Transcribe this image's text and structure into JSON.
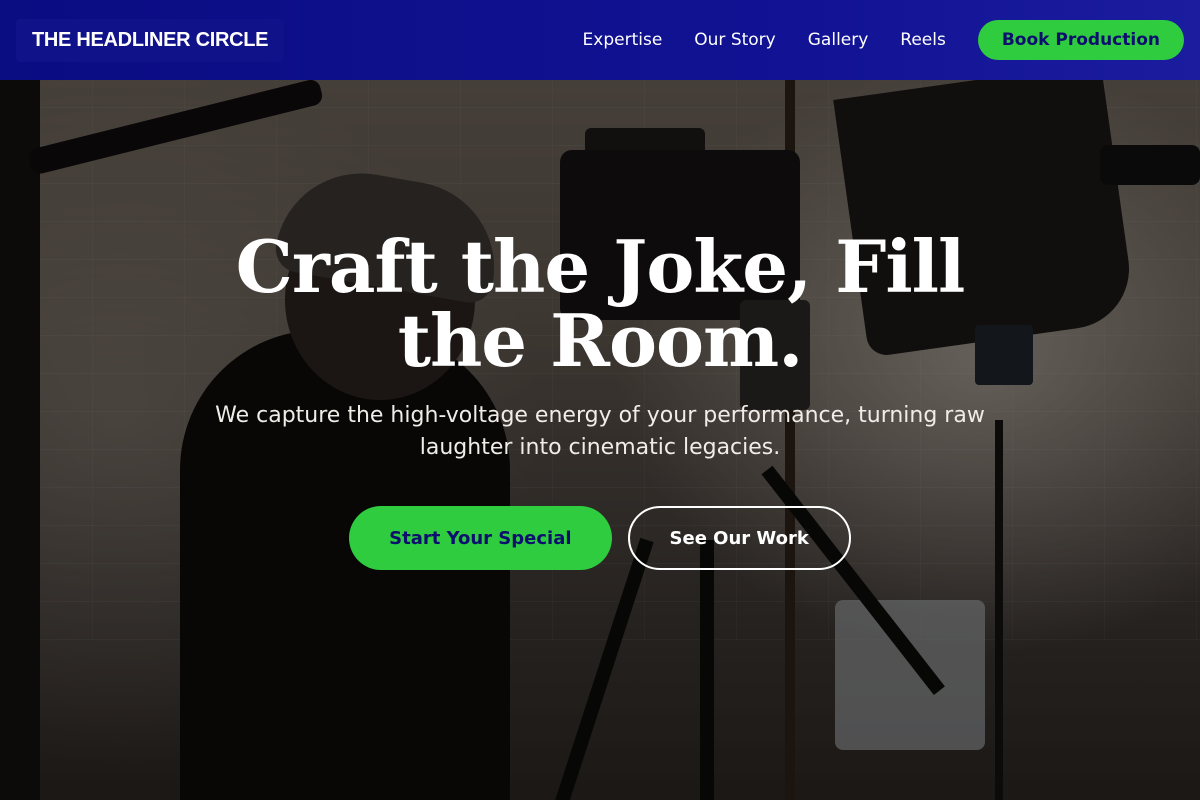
{
  "nav": {
    "brand": "THE HEADLINER CIRCLE",
    "links": [
      "Expertise",
      "Our Story",
      "Gallery",
      "Reels"
    ],
    "cta_label": "Book Production"
  },
  "hero": {
    "headline": "Craft the Joke, Fill the Room.",
    "subline": "We capture the high-voltage energy of your performance, turning raw laughter into cinematic legacies.",
    "primary_button": "Start Your Special",
    "secondary_button": "See Our Work"
  },
  "colors": {
    "nav_bg": "#0a0c82",
    "accent_green": "#2ecc3e",
    "accent_text_navy": "#0d0f6e"
  },
  "icons": []
}
